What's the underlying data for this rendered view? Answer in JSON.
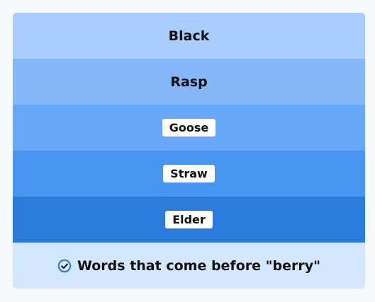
{
  "rows": [
    {
      "text": "Black",
      "color": "#a9cdff",
      "style": "plain"
    },
    {
      "text": "Rasp",
      "color": "#85b7fa",
      "style": "plain"
    },
    {
      "text": "Goose",
      "color": "#66a7f8",
      "style": "chip"
    },
    {
      "text": "Straw",
      "color": "#4795f1",
      "style": "chip"
    },
    {
      "text": "Elder",
      "color": "#2b7bdb",
      "style": "chip"
    }
  ],
  "footer": {
    "text": "Words that come before \"berry\"",
    "color": "#d3e8ff",
    "icon": "check-circle-icon",
    "icon_color": "#2b7bdb"
  }
}
